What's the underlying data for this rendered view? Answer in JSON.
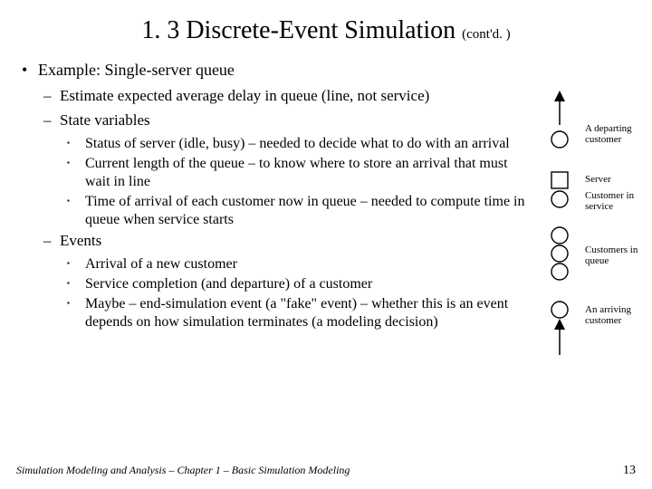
{
  "title": "1. 3  Discrete-Event Simulation ",
  "title_cont": "(cont'd. )",
  "bullets": {
    "l1": "Example:  Single-server queue",
    "l2a": "Estimate expected average delay in queue (line, not service)",
    "l2b": "State variables",
    "sv1": "Status of server (idle, busy) – needed to decide what to do with an arrival",
    "sv2": "Current length of the queue – to know where to store an arrival that must wait in line",
    "sv3": "Time of arrival of each customer now in queue – needed to compute time in queue when service starts",
    "l2c": "Events",
    "ev1": "Arrival of a new customer",
    "ev2": "Service completion (and departure) of a customer",
    "ev3": "Maybe – end-simulation event (a \"fake\" event) – whether this is an event depends on how simulation terminates (a modeling decision)"
  },
  "diagram": {
    "depart": "A departing customer",
    "server": "Server",
    "inservice": "Customer in service",
    "inqueue": "Customers in queue",
    "arriving": "An arriving customer"
  },
  "footer": "Simulation Modeling and Analysis – Chapter 1 –  Basic Simulation Modeling",
  "page": "13"
}
